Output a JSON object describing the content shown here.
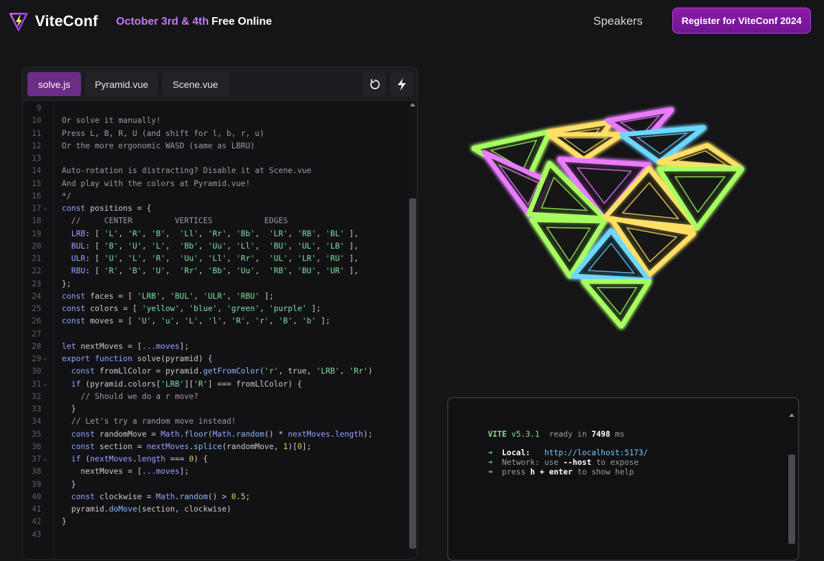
{
  "header": {
    "brand": "ViteConf",
    "date": "October 3rd & 4th",
    "free": "Free Online",
    "nav_speakers": "Speakers",
    "register_label": "Register for ViteConf 2024"
  },
  "editor": {
    "tabs": [
      {
        "label": "solve.js",
        "active": true
      },
      {
        "label": "Pyramid.vue",
        "active": false
      },
      {
        "label": "Scene.vue",
        "active": false
      }
    ],
    "icons": [
      "reset-icon",
      "lightning-icon"
    ],
    "lines": [
      {
        "n": "9",
        "text": ""
      },
      {
        "n": "10",
        "text": "Or solve it manually!"
      },
      {
        "n": "11",
        "text": "Press L, B, R, U (and shift for l, b, r, u)"
      },
      {
        "n": "12",
        "text": "Or the more ergonomic WASD (same as LBRU)"
      },
      {
        "n": "13",
        "text": ""
      },
      {
        "n": "14",
        "text": "Auto-rotation is distracting? Disable it at Scene.vue"
      },
      {
        "n": "15",
        "text": "And play with the colors at Pyramid.vue!"
      },
      {
        "n": "16",
        "text": "*/"
      },
      {
        "n": "17",
        "text": "const positions = {",
        "fold": true
      },
      {
        "n": "18",
        "text": "  //     CENTER         VERTICES           EDGES"
      },
      {
        "n": "19",
        "text": "  LRB: [ 'L', 'R', 'B',  'Ll', 'Rr', 'Bb',  'LR', 'RB', 'BL' ],"
      },
      {
        "n": "20",
        "text": "  BUL: [ 'B', 'U', 'L',  'Bb', 'Uu', 'Ll',  'BU', 'UL', 'LB' ],"
      },
      {
        "n": "21",
        "text": "  ULR: [ 'U', 'L', 'R',  'Uu', 'Ll', 'Rr',  'UL', 'LR', 'RU' ],"
      },
      {
        "n": "22",
        "text": "  RBU: [ 'R', 'B', 'U',  'Rr', 'Bb', 'Uu',  'RB', 'BU', 'UR' ],"
      },
      {
        "n": "23",
        "text": "};"
      },
      {
        "n": "24",
        "text": "const faces = [ 'LRB', 'BUL', 'ULR', 'RBU' ];"
      },
      {
        "n": "25",
        "text": "const colors = [ 'yellow', 'blue', 'green', 'purple' ];"
      },
      {
        "n": "26",
        "text": "const moves = [ 'U', 'u', 'L', 'l', 'R', 'r', 'B', 'b' ];"
      },
      {
        "n": "27",
        "text": ""
      },
      {
        "n": "28",
        "text": "let nextMoves = [...moves];"
      },
      {
        "n": "29",
        "text": "export function solve(pyramid) {",
        "fold": true
      },
      {
        "n": "30",
        "text": "  const fromLlColor = pyramid.getFromColor('r', true, 'LRB', 'Rr')"
      },
      {
        "n": "31",
        "text": "  if (pyramid.colors['LRB']['R'] === fromLlColor) {",
        "fold": true
      },
      {
        "n": "32",
        "text": "    // Should we do a r move?"
      },
      {
        "n": "33",
        "text": "  }"
      },
      {
        "n": "34",
        "text": "  // Let's try a random move instead!"
      },
      {
        "n": "35",
        "text": "  const randomMove = Math.floor(Math.random() * nextMoves.length);"
      },
      {
        "n": "36",
        "text": "  const section = nextMoves.splice(randomMove, 1)[0];"
      },
      {
        "n": "37",
        "text": "  if (nextMoves.length === 0) {",
        "fold": true
      },
      {
        "n": "38",
        "text": "    nextMoves = [...moves];"
      },
      {
        "n": "39",
        "text": "  }"
      },
      {
        "n": "40",
        "text": "  const clockwise = Math.random() > 0.5;"
      },
      {
        "n": "41",
        "text": "  pyramid.doMove(section, clockwise)"
      },
      {
        "n": "42",
        "text": "}"
      },
      {
        "n": "43",
        "text": ""
      }
    ]
  },
  "terminal": {
    "vite": "VITE",
    "version": "v5.3.1",
    "ready": "ready in",
    "ready_ms": "7498",
    "ready_unit": "ms",
    "local_label": "Local:",
    "local_url": "http://localhost:5173/",
    "network_label": "Network:",
    "network_text_1": "use",
    "network_flag": "--host",
    "network_text_2": "to expose",
    "help_text_1": "press",
    "help_key": "h + enter",
    "help_text_2": "to show help",
    "arrow": "➜"
  },
  "colors": {
    "accent": "#8a1ca7",
    "brand_date": "#c879f0",
    "tri_yellow": "#ffe066",
    "tri_green": "#a8ff60",
    "tri_purple": "#ea7bff",
    "tri_blue": "#6cd8ff"
  }
}
